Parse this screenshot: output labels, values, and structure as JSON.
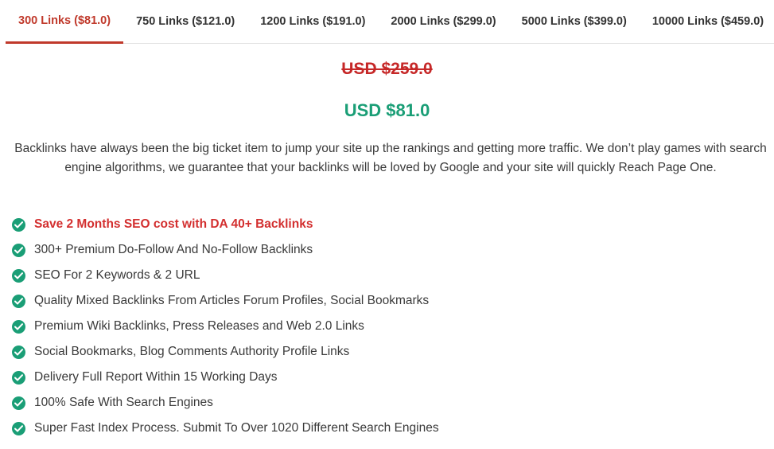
{
  "tabs": [
    {
      "label": "300 Links ($81.0)",
      "active": true
    },
    {
      "label": "750 Links ($121.0)",
      "active": false
    },
    {
      "label": "1200 Links ($191.0)",
      "active": false
    },
    {
      "label": "2000 Links ($299.0)",
      "active": false
    },
    {
      "label": "5000 Links ($399.0)",
      "active": false
    },
    {
      "label": "10000 Links ($459.0)",
      "active": false
    }
  ],
  "pricing": {
    "old_price": "USD $259.0",
    "new_price": "USD $81.0"
  },
  "description": "Backlinks have always been the big ticket item to jump your site up the rankings and getting more traffic. We don’t play games with search engine algorithms, we guarantee that your backlinks will be loved by Google and your site will quickly Reach Page One.",
  "features": [
    {
      "text": "Save 2 Months SEO cost with DA 40+ Backlinks",
      "icon": "check-circle-icon"
    },
    {
      "text": "300+ Premium Do-Follow And No-Follow Backlinks",
      "icon": "check-circle-icon"
    },
    {
      "text": "SEO For 2 Keywords & 2 URL",
      "icon": "check-circle-icon"
    },
    {
      "text": "Quality Mixed Backlinks From Articles Forum Profiles, Social Bookmarks",
      "icon": "check-circle-icon"
    },
    {
      "text": "Premium Wiki Backlinks, Press Releases and Web 2.0 Links",
      "icon": "check-circle-icon"
    },
    {
      "text": "Social Bookmarks, Blog Comments Authority Profile Links",
      "icon": "check-circle-icon"
    },
    {
      "text": "Delivery Full Report Within 15 Working Days",
      "icon": "check-circle-icon"
    },
    {
      "text": "100% Safe With Search Engines",
      "icon": "check-circle-icon"
    },
    {
      "text": "Super Fast Index Process. Submit To Over 1020 Different Search Engines",
      "icon": "check-circle-icon"
    }
  ],
  "colors": {
    "accent_red": "#c0392b",
    "price_green": "#1a9e76",
    "old_price_red": "#c62828",
    "highlight_red": "#d32f2f",
    "check_green": "#1a9e76"
  }
}
